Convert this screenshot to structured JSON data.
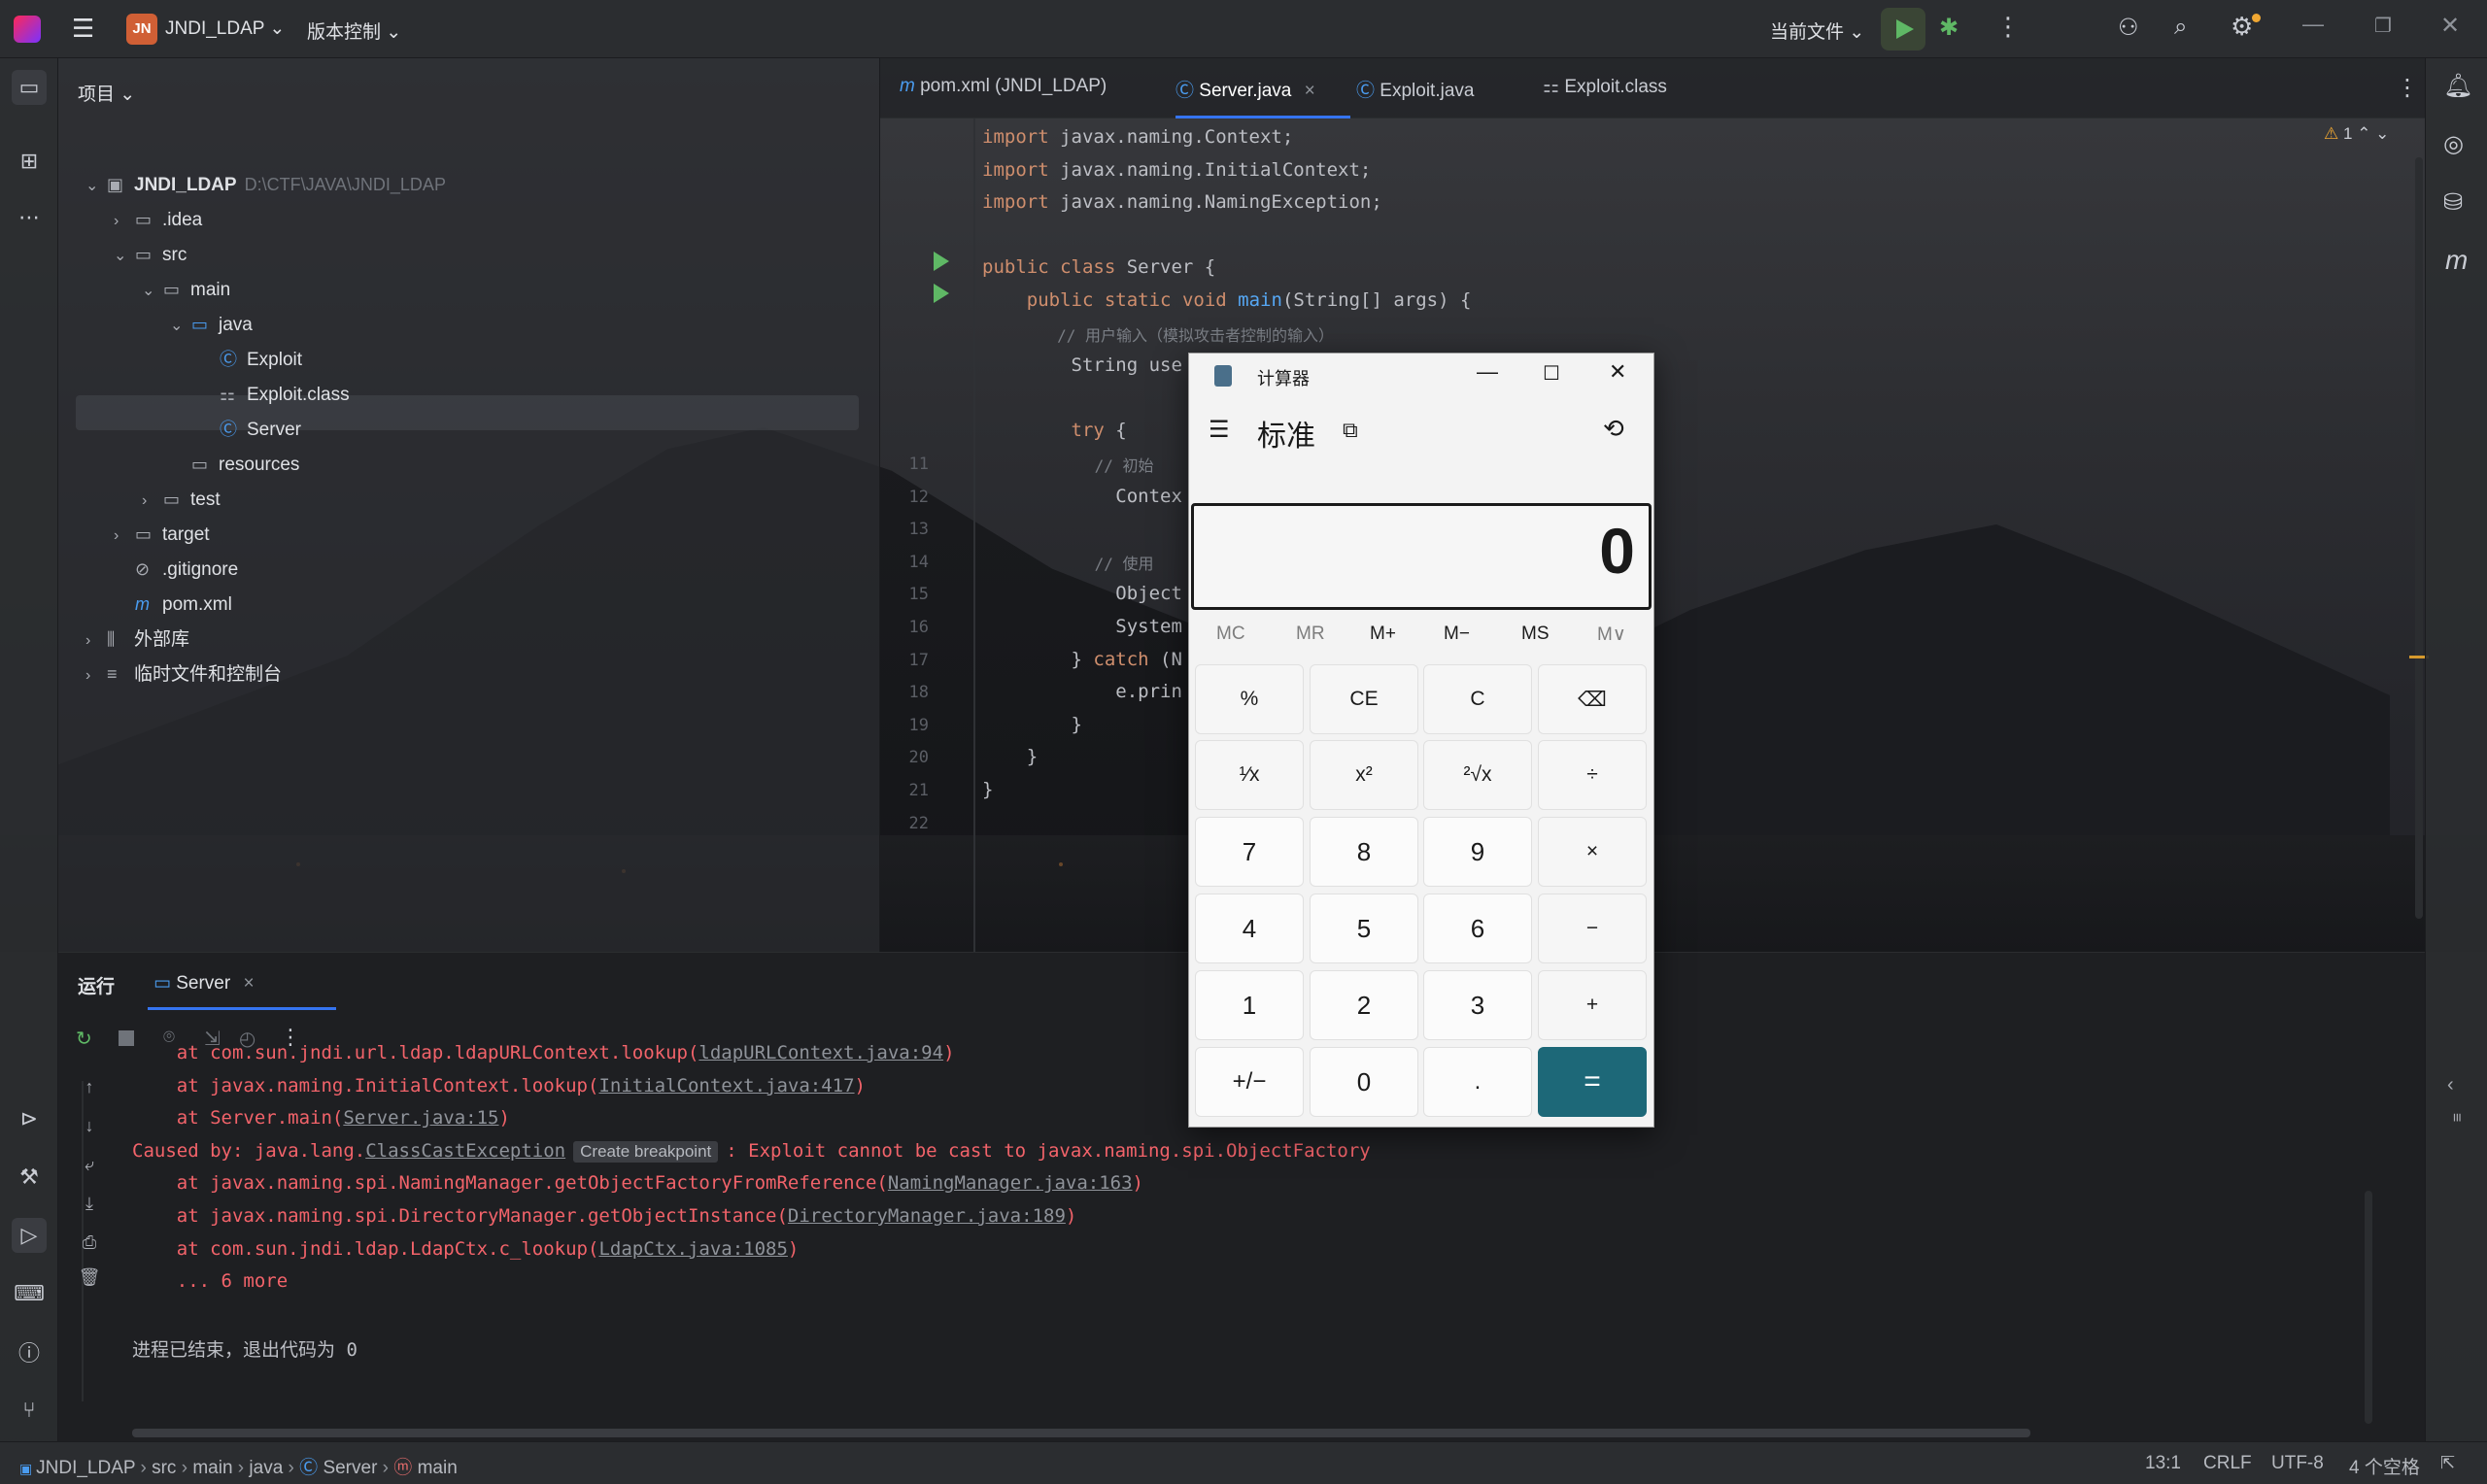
{
  "titlebar": {
    "project_badge": "JN",
    "project_name": "JNDI_LDAP",
    "vcs": "版本控制",
    "run_config": "当前文件"
  },
  "project_panel": {
    "header": "项目",
    "tree": [
      {
        "label": "JNDI_LDAP",
        "path": "D:\\CTF\\JAVA\\JNDI_LDAP",
        "level": 0,
        "expanded": true,
        "icon": "module-icon"
      },
      {
        "label": ".idea",
        "level": 1,
        "expanded": false,
        "icon": "folder-icon"
      },
      {
        "label": "src",
        "level": 1,
        "expanded": true,
        "icon": "folder-icon"
      },
      {
        "label": "main",
        "level": 2,
        "expanded": true,
        "icon": "folder-icon"
      },
      {
        "label": "java",
        "level": 3,
        "expanded": true,
        "icon": "source-folder-icon"
      },
      {
        "label": "Exploit",
        "level": 4,
        "icon": "java-class-icon"
      },
      {
        "label": "Exploit.class",
        "level": 4,
        "icon": "class-file-icon",
        "selected": true
      },
      {
        "label": "Server",
        "level": 4,
        "icon": "java-class-icon"
      },
      {
        "label": "resources",
        "level": 3,
        "icon": "resources-folder-icon"
      },
      {
        "label": "test",
        "level": 2,
        "expanded": false,
        "icon": "folder-icon"
      },
      {
        "label": "target",
        "level": 1,
        "expanded": false,
        "icon": "folder-icon"
      },
      {
        "label": ".gitignore",
        "level": 1,
        "icon": "gitignore-icon"
      },
      {
        "label": "pom.xml",
        "level": 1,
        "icon": "maven-icon"
      },
      {
        "label": "外部库",
        "level": 0,
        "expanded": false,
        "icon": "library-icon"
      },
      {
        "label": "临时文件和控制台",
        "level": 0,
        "expanded": false,
        "icon": "scratch-icon"
      }
    ]
  },
  "editor_tabs": [
    {
      "label": "pom.xml (JNDI_LDAP)",
      "icon": "maven-icon"
    },
    {
      "label": "Server.java",
      "icon": "java-class-icon",
      "active": true
    },
    {
      "label": "Exploit.java",
      "icon": "java-class-icon"
    },
    {
      "label": "Exploit.class",
      "icon": "class-file-icon"
    }
  ],
  "editor": {
    "warning_count": "1",
    "lines": [
      {
        "n": "",
        "text": "import javax.naming.Context;"
      },
      {
        "n": "",
        "text": "import javax.naming.InitialContext;"
      },
      {
        "n": "",
        "text": "import javax.naming.NamingException;"
      },
      {
        "n": "",
        "text": ""
      },
      {
        "n": "",
        "text": "public class Server {"
      },
      {
        "n": "",
        "text": "    public static void main(String[] args) {"
      },
      {
        "n": "",
        "text": "        // 用户输入（模拟攻击者控制的输入）"
      },
      {
        "n": "",
        "text": "        String use"
      },
      {
        "n": "",
        "text": ""
      },
      {
        "n": "",
        "text": "        try {"
      },
      {
        "n": "11",
        "text": "            // 初始"
      },
      {
        "n": "12",
        "text": "            Contex"
      },
      {
        "n": "13",
        "text": ""
      },
      {
        "n": "14",
        "text": "            // 使用"
      },
      {
        "n": "15",
        "text": "            Object"
      },
      {
        "n": "16",
        "text": "            System"
      },
      {
        "n": "17",
        "text": "        } catch (N"
      },
      {
        "n": "18",
        "text": "            e.prin"
      },
      {
        "n": "19",
        "text": "        }"
      },
      {
        "n": "20",
        "text": "    }"
      },
      {
        "n": "21",
        "text": "}"
      },
      {
        "n": "22",
        "text": ""
      }
    ]
  },
  "run_panel": {
    "title": "运行",
    "tab": "Server",
    "output": [
      {
        "pre": "    at com.sun.jndi.url.ldap.ldapURLContext.lookup(",
        "link": "ldapURLContext.java:94",
        "post": ")"
      },
      {
        "pre": "    at javax.naming.InitialContext.lookup(",
        "link": "InitialContext.java:417",
        "post": ")"
      },
      {
        "pre": "    at Server.main(",
        "link": "Server.java:15",
        "post": ")"
      },
      {
        "pre": "Caused by: java.lang.",
        "link": "ClassCastException",
        "chip": "Create breakpoint",
        "post": ": Exploit cannot be cast to javax.naming.spi.ObjectFactory"
      },
      {
        "pre": "    at javax.naming.spi.NamingManager.getObjectFactoryFromReference(",
        "link": "NamingManager.java:163",
        "post": ")"
      },
      {
        "pre": "    at javax.naming.spi.DirectoryManager.getObjectInstance(",
        "link": "DirectoryManager.java:189",
        "post": ")"
      },
      {
        "pre": "    at com.sun.jndi.ldap.LdapCtx.c_lookup(",
        "link": "LdapCtx.java:1085",
        "post": ")"
      },
      {
        "pre": "    ... 6 more",
        "link": "",
        "post": ""
      },
      {
        "pre": "",
        "link": "",
        "post": ""
      },
      {
        "pre": "进程已结束，退出代码为 0",
        "link": "",
        "post": "",
        "plain": true
      }
    ]
  },
  "statusbar": {
    "breadcrumb": [
      "JNDI_LDAP",
      "src",
      "main",
      "java",
      "Server",
      "main"
    ],
    "position": "13:1",
    "line_sep": "CRLF",
    "encoding": "UTF-8",
    "indent": "4 个空格"
  },
  "calculator": {
    "title": "计算器",
    "mode": "标准",
    "display": "0",
    "memory": [
      "MC",
      "MR",
      "M+",
      "M−",
      "MS",
      "M∨"
    ],
    "keys": [
      [
        "%",
        "CE",
        "C",
        "⌫"
      ],
      [
        "¹⁄x",
        "x²",
        "²√x",
        "÷"
      ],
      [
        "7",
        "8",
        "9",
        "×"
      ],
      [
        "4",
        "5",
        "6",
        "−"
      ],
      [
        "1",
        "2",
        "3",
        "+"
      ],
      [
        "+/−",
        "0",
        ".",
        "="
      ]
    ]
  },
  "colors": {
    "accent": "#3574f0",
    "equals_button": "#1d6878",
    "error_text": "#f2636a",
    "run_green": "#5fb865"
  }
}
